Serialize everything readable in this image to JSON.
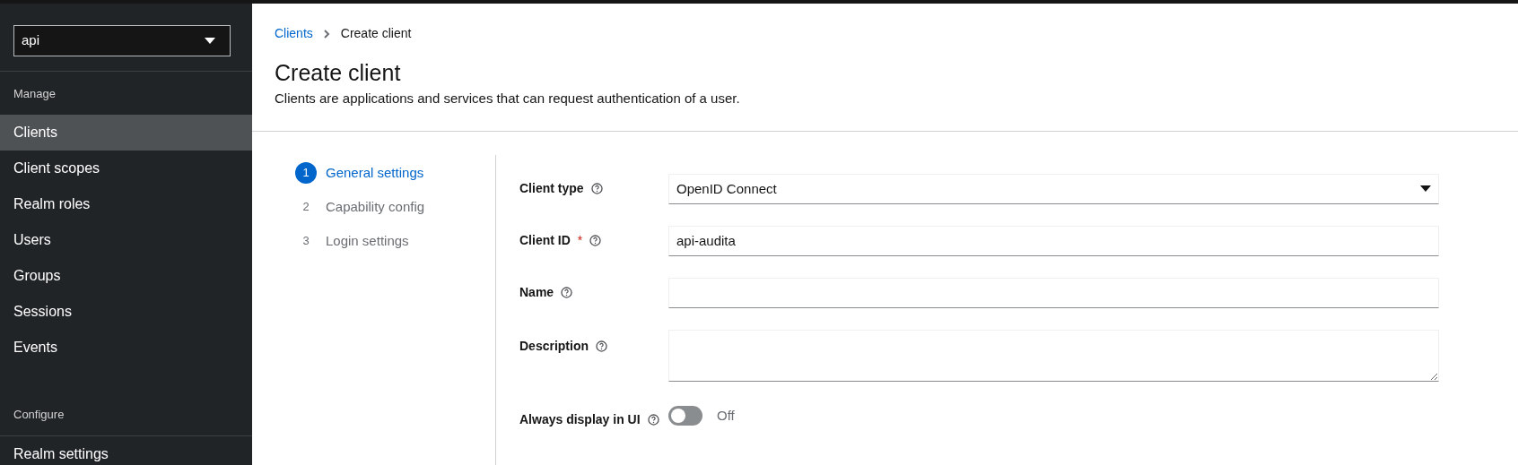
{
  "sidebar": {
    "realm_select": {
      "value": "api"
    },
    "sections": [
      {
        "heading": "Manage",
        "items": [
          {
            "label": "Clients",
            "selected": true
          },
          {
            "label": "Client scopes",
            "selected": false
          },
          {
            "label": "Realm roles",
            "selected": false
          },
          {
            "label": "Users",
            "selected": false
          },
          {
            "label": "Groups",
            "selected": false
          },
          {
            "label": "Sessions",
            "selected": false
          },
          {
            "label": "Events",
            "selected": false
          }
        ]
      },
      {
        "heading": "Configure",
        "items": [
          {
            "label": "Realm settings",
            "selected": false
          }
        ]
      }
    ]
  },
  "breadcrumb": [
    {
      "label": "Clients",
      "kind": "link"
    },
    {
      "label": "Create client",
      "kind": "current"
    }
  ],
  "page": {
    "title": "Create client",
    "description": "Clients are applications and services that can request authentication of a user."
  },
  "wizard_steps": [
    {
      "number": "1",
      "label": "General settings",
      "selected": true
    },
    {
      "number": "2",
      "label": "Capability config",
      "selected": false
    },
    {
      "number": "3",
      "label": "Login settings",
      "selected": false
    }
  ],
  "form": [
    {
      "kind": "select",
      "label": "Client type",
      "value": "OpenID Connect"
    },
    {
      "kind": "text",
      "label": "Client ID",
      "required_mark": "*",
      "value": "api-audita"
    },
    {
      "kind": "text",
      "label": "Name"
    },
    {
      "kind": "textarea",
      "label": "Description"
    },
    {
      "kind": "switch",
      "label": "Always display in UI",
      "on": false,
      "state_text": "Off"
    }
  ]
}
